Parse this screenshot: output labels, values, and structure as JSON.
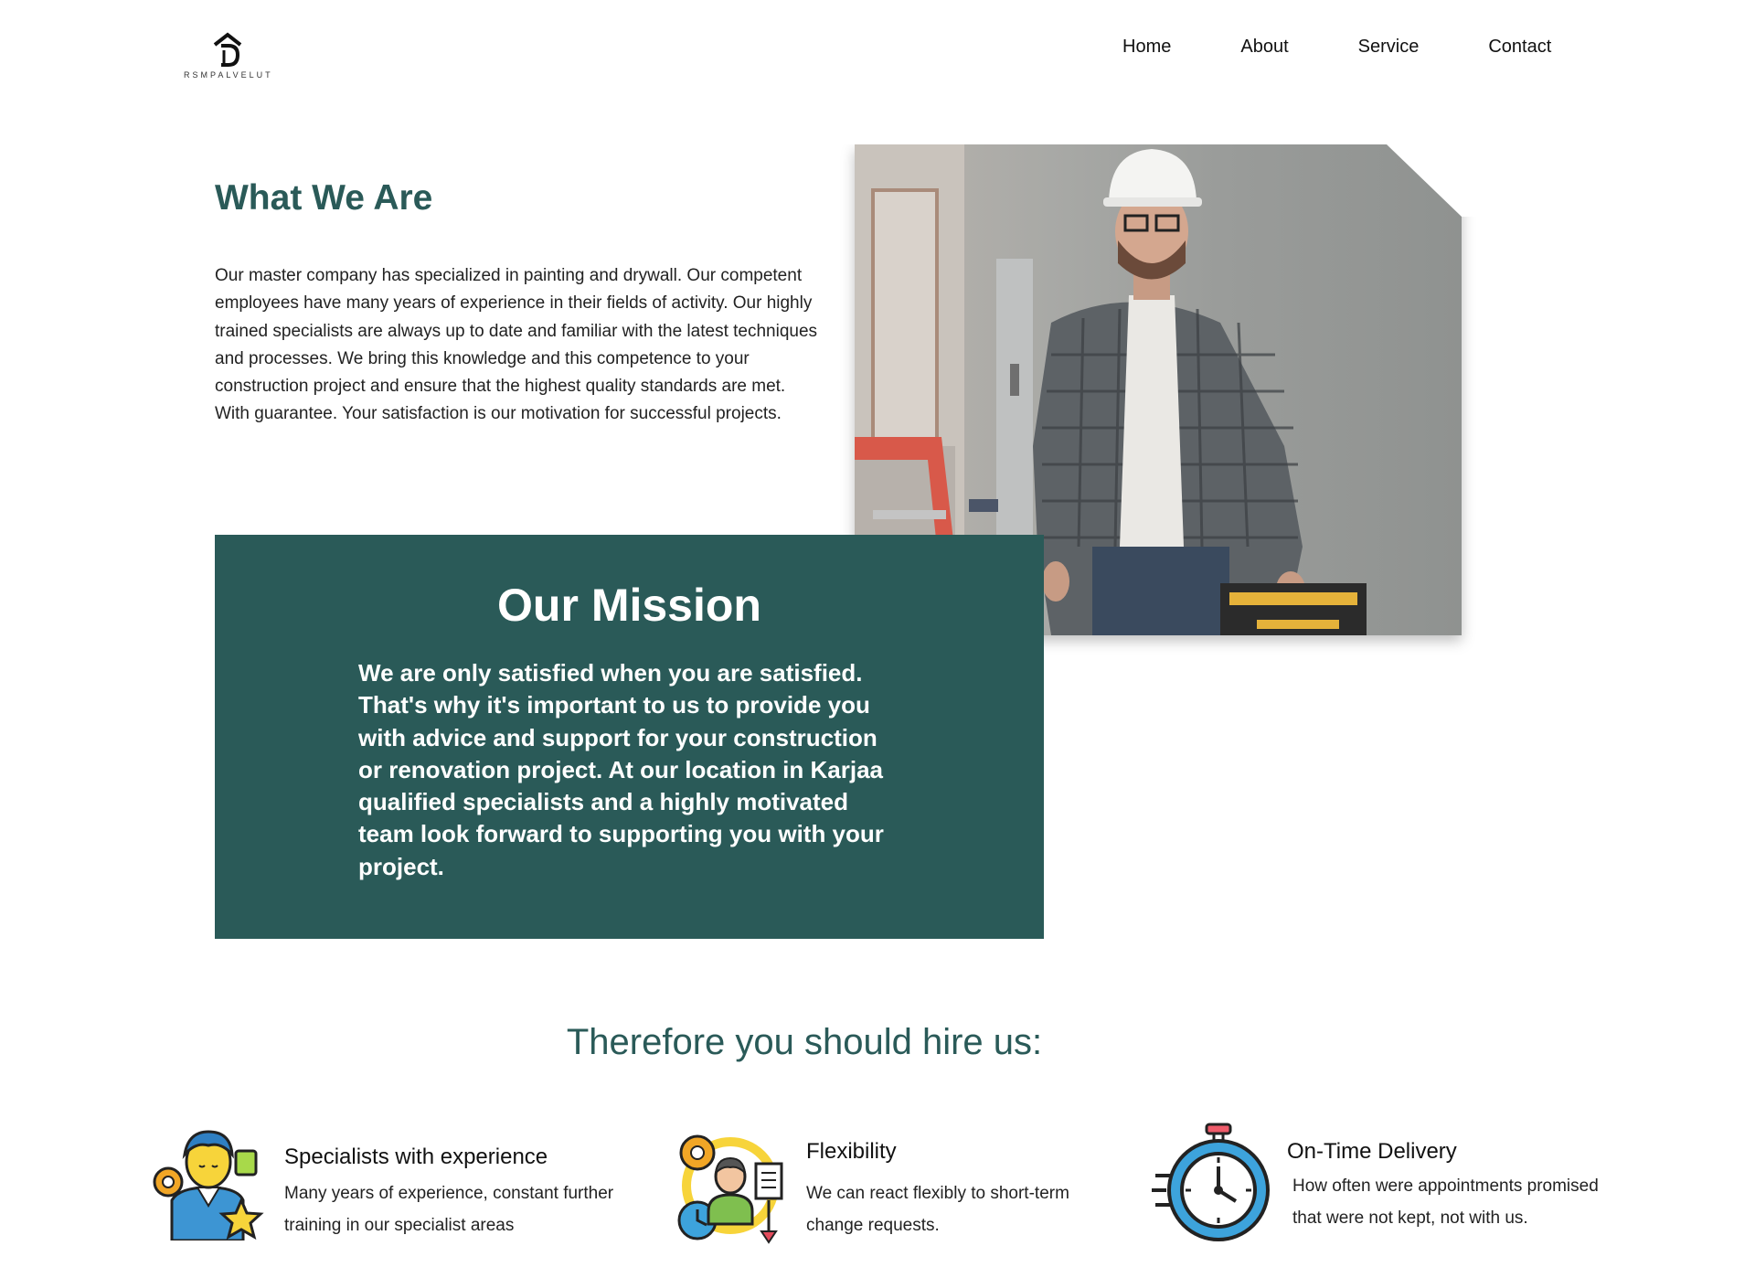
{
  "header": {
    "logo_text": "RSMPALVELUT",
    "nav": [
      "Home",
      "About",
      "Service",
      "Contact"
    ]
  },
  "about": {
    "title": "What We Are",
    "text": "Our master company has specialized in painting and drywall. Our competent employees have many years of experience in their fields of activity. Our highly trained specialists are always up to date and familiar with the latest techniques and processes. We bring this knowledge and this competence to your construction project and ensure that the highest quality standards are met. With guarantee. Your satisfaction is our motivation for successful projects."
  },
  "mission": {
    "title": "Our Mission",
    "text": "We are only satisfied when you are satisfied. That's why it's important to us to provide you with advice and support for your construction or renovation project. At our location in Karjaa qualified specialists and a highly motivated team look forward to supporting you with your project."
  },
  "hire": {
    "title": "Therefore you should hire us:",
    "features": [
      {
        "title": "Specialists with experience",
        "desc": "Many years of experience, constant further\ntraining in our specialist areas",
        "icon": "specialist-icon"
      },
      {
        "title": "Flexibility",
        "desc": "We can react flexibly to short-term\n change requests.",
        "icon": "flexibility-icon"
      },
      {
        "title": "On-Time Delivery",
        "desc": "How often were appointments promised\nthat were not kept, not with us.",
        "icon": "stopwatch-icon"
      }
    ]
  },
  "colors": {
    "accent": "#2a5a58",
    "text": "#111111",
    "background": "#ffffff"
  }
}
